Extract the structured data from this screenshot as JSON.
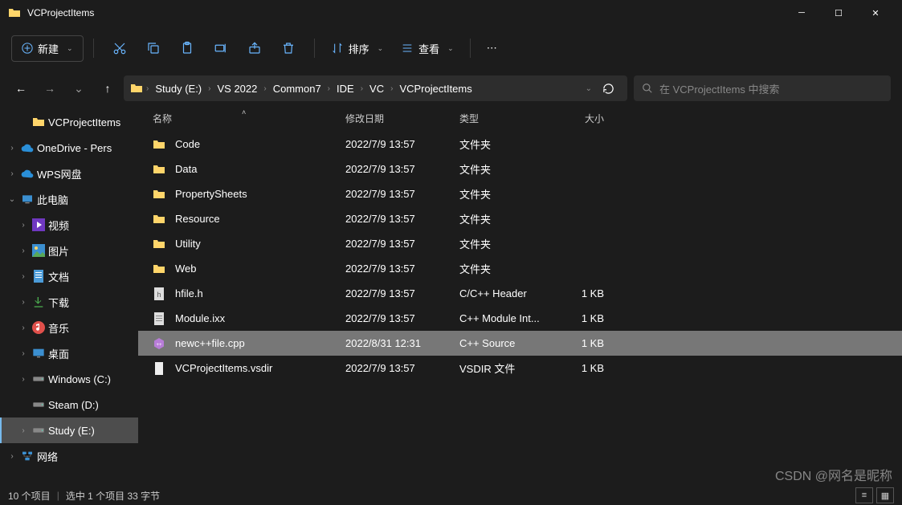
{
  "window": {
    "title": "VCProjectItems"
  },
  "toolbar": {
    "new_label": "新建",
    "sort_label": "排序",
    "view_label": "查看"
  },
  "breadcrumb": {
    "parts": [
      "Study (E:)",
      "VS 2022",
      "Common7",
      "IDE",
      "VC",
      "VCProjectItems"
    ]
  },
  "search": {
    "placeholder": "在 VCProjectItems 中搜索"
  },
  "sidebar": {
    "items": [
      {
        "label": "VCProjectItems",
        "icon": "folder",
        "indent": 1,
        "expand": ""
      },
      {
        "label": "OneDrive - Pers",
        "icon": "cloud",
        "indent": 0,
        "expand": "›"
      },
      {
        "label": "WPS网盘",
        "icon": "wps",
        "indent": 0,
        "expand": "›"
      },
      {
        "label": "此电脑",
        "icon": "pc",
        "indent": 0,
        "expand": "⌄",
        "expanded": true
      },
      {
        "label": "视频",
        "icon": "video",
        "indent": 1,
        "expand": "›"
      },
      {
        "label": "图片",
        "icon": "picture",
        "indent": 1,
        "expand": "›"
      },
      {
        "label": "文档",
        "icon": "document",
        "indent": 1,
        "expand": "›"
      },
      {
        "label": "下载",
        "icon": "download",
        "indent": 1,
        "expand": "›"
      },
      {
        "label": "音乐",
        "icon": "music",
        "indent": 1,
        "expand": "›"
      },
      {
        "label": "桌面",
        "icon": "desktop",
        "indent": 1,
        "expand": "›"
      },
      {
        "label": "Windows (C:)",
        "icon": "drive",
        "indent": 1,
        "expand": "›"
      },
      {
        "label": "Steam (D:)",
        "icon": "drive",
        "indent": 1,
        "expand": ""
      },
      {
        "label": "Study (E:)",
        "icon": "drive",
        "indent": 1,
        "expand": "›",
        "selected": true
      },
      {
        "label": "网络",
        "icon": "network",
        "indent": 0,
        "expand": "›"
      }
    ]
  },
  "columns": {
    "name": "名称",
    "date": "修改日期",
    "type": "类型",
    "size": "大小"
  },
  "files": [
    {
      "name": "Code",
      "date": "2022/7/9 13:57",
      "type": "文件夹",
      "size": "",
      "icon": "folder"
    },
    {
      "name": "Data",
      "date": "2022/7/9 13:57",
      "type": "文件夹",
      "size": "",
      "icon": "folder"
    },
    {
      "name": "PropertySheets",
      "date": "2022/7/9 13:57",
      "type": "文件夹",
      "size": "",
      "icon": "folder"
    },
    {
      "name": "Resource",
      "date": "2022/7/9 13:57",
      "type": "文件夹",
      "size": "",
      "icon": "folder"
    },
    {
      "name": "Utility",
      "date": "2022/7/9 13:57",
      "type": "文件夹",
      "size": "",
      "icon": "folder"
    },
    {
      "name": "Web",
      "date": "2022/7/9 13:57",
      "type": "文件夹",
      "size": "",
      "icon": "folder"
    },
    {
      "name": "hfile.h",
      "date": "2022/7/9 13:57",
      "type": "C/C++ Header",
      "size": "1 KB",
      "icon": "hfile"
    },
    {
      "name": "Module.ixx",
      "date": "2022/7/9 13:57",
      "type": "C++ Module Int...",
      "size": "1 KB",
      "icon": "module"
    },
    {
      "name": "newc++file.cpp",
      "date": "2022/8/31 12:31",
      "type": "C++ Source",
      "size": "1 KB",
      "icon": "cpp",
      "selected": true
    },
    {
      "name": "VCProjectItems.vsdir",
      "date": "2022/7/9 13:57",
      "type": "VSDIR 文件",
      "size": "1 KB",
      "icon": "file"
    }
  ],
  "status": {
    "count": "10 个项目",
    "selection": "选中 1 个项目  33 字节"
  },
  "watermark": "CSDN @网名是昵称"
}
